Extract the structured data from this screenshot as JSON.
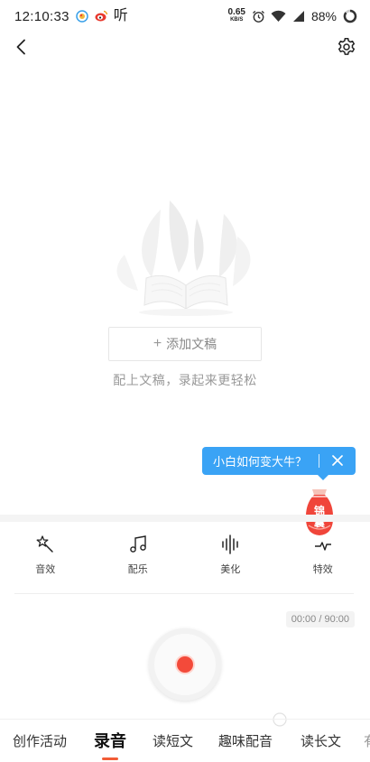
{
  "status_bar": {
    "time": "12:10:33",
    "app_icons": [
      "weibo-icon",
      "weibo-red-icon",
      "ting-icon"
    ],
    "ting_glyph": "听",
    "net_speed_value": "0.65",
    "net_speed_unit": "KB/S",
    "battery_percent": "88%"
  },
  "nav": {
    "back_icon": "chevron-left-icon",
    "settings_icon": "gear-icon"
  },
  "empty_state": {
    "add_script_label": "添加文稿",
    "add_script_prefix": "+",
    "hint": "配上文稿，录起来更轻松"
  },
  "tooltip": {
    "text": "小白如何变大牛？",
    "close_icon": "close-icon",
    "color": "#3aa3f5"
  },
  "bag_badge": {
    "line1": "锦",
    "line2": "囊",
    "color": "#f0453a"
  },
  "effects": [
    {
      "label": "音效",
      "icon": "magic-wand-icon"
    },
    {
      "label": "配乐",
      "icon": "music-note-icon"
    },
    {
      "label": "美化",
      "icon": "waveform-icon"
    },
    {
      "label": "特效",
      "icon": "special-effect-icon"
    }
  ],
  "recorder": {
    "timer": "00:00 / 90:00",
    "record_color": "#f34a3a"
  },
  "tabs": [
    {
      "label": "创作活动",
      "active": false
    },
    {
      "label": "录音",
      "active": true
    },
    {
      "label": "读短文",
      "active": false
    },
    {
      "label": "趣味配音",
      "active": false
    },
    {
      "label": "读长文",
      "active": false
    },
    {
      "label": "有",
      "active": false
    }
  ],
  "accent_color": "#f25c36"
}
